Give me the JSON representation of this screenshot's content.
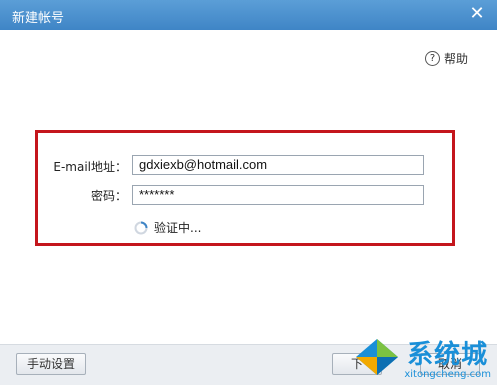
{
  "window": {
    "title": "新建帐号",
    "close_symbol": "✕"
  },
  "help": {
    "icon": "?",
    "label": "帮助"
  },
  "form": {
    "email_label": "E-mail地址：",
    "email_value": "gdxiexb@hotmail.com",
    "password_label": "密码：",
    "password_value": "*******",
    "status_text": "验证中..."
  },
  "footer": {
    "manual_setup_label": "手动设置",
    "next_label": "下",
    "cancel_label": "取消"
  },
  "watermark": {
    "cn": "系统城",
    "en": "xitongcheng.com"
  },
  "colors": {
    "titlebar": "#4a90d0",
    "highlight_border": "#c4161c",
    "watermark": "#1a8fd8"
  }
}
